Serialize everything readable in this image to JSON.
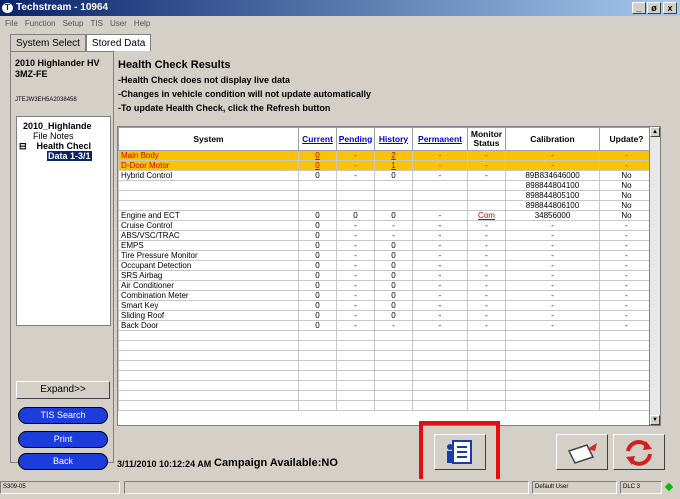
{
  "window": {
    "title": "Techstream - 10964",
    "min": "_",
    "max": "ø",
    "close": "x",
    "icon": "T"
  },
  "menu": [
    "File",
    "Function",
    "Setup",
    "TIS",
    "User",
    "Help"
  ],
  "tabs": [
    "System Select",
    "Stored Data"
  ],
  "vehicle": {
    "line1": "2010 Highlander HV",
    "line2": "3MZ-FE",
    "vin": "JTEJW3EH5A2038458"
  },
  "tree": {
    "root": "2010_Highlande",
    "file_notes": "File Notes",
    "toggle": "⊟",
    "health": "Health Checl",
    "data": "Data 1-3/1"
  },
  "left_buttons": {
    "expand": "Expand>>",
    "tis_search": "TIS Search",
    "print": "Print",
    "back": "Back"
  },
  "health": {
    "title": "Health Check Results",
    "notes": [
      "-Health Check does not display live data",
      "-Changes in vehicle condition will not update automatically",
      "-To update Health Check, click the Refresh button"
    ]
  },
  "table": {
    "headers": [
      "System",
      "Current",
      "Pending",
      "History",
      "Permanent",
      "Monitor Status",
      "Calibration",
      "Update?"
    ],
    "rows": [
      {
        "sys": "Main Body",
        "cur": "0",
        "pen": "-",
        "his": "2",
        "perm": "-",
        "mon": "-",
        "cal": "-",
        "upd": "-",
        "hl": true
      },
      {
        "sys": "D-Door Motor",
        "cur": "0",
        "pen": "-",
        "his": "1",
        "perm": "-",
        "mon": "-",
        "cal": "-",
        "upd": "-",
        "hl": true
      },
      {
        "sys": "Hybrid Control",
        "cur": "0",
        "pen": "-",
        "his": "0",
        "perm": "-",
        "mon": "-",
        "cal": "89B834646000",
        "upd": "No"
      },
      {
        "sys": "",
        "cur": "",
        "pen": "",
        "his": "",
        "perm": "",
        "mon": "",
        "cal": "898844804100",
        "upd": "No"
      },
      {
        "sys": "",
        "cur": "",
        "pen": "",
        "his": "",
        "perm": "",
        "mon": "",
        "cal": "898844805100",
        "upd": "No"
      },
      {
        "sys": "",
        "cur": "",
        "pen": "",
        "his": "",
        "perm": "",
        "mon": "",
        "cal": "898844806100",
        "upd": "No"
      },
      {
        "sys": "Engine and ECT",
        "cur": "0",
        "pen": "0",
        "his": "0",
        "perm": "-",
        "mon": "Com",
        "cal": "34856000",
        "upd": "No"
      },
      {
        "sys": "Cruise Control",
        "cur": "0",
        "pen": "-",
        "his": "-",
        "perm": "-",
        "mon": "-",
        "cal": "-",
        "upd": "-"
      },
      {
        "sys": "ABS/VSC/TRAC",
        "cur": "0",
        "pen": "-",
        "his": "-",
        "perm": "-",
        "mon": "-",
        "cal": "-",
        "upd": "-"
      },
      {
        "sys": "EMPS",
        "cur": "0",
        "pen": "-",
        "his": "0",
        "perm": "-",
        "mon": "-",
        "cal": "-",
        "upd": "-"
      },
      {
        "sys": "Tire Pressure Monitor",
        "cur": "0",
        "pen": "-",
        "his": "0",
        "perm": "-",
        "mon": "-",
        "cal": "-",
        "upd": "-"
      },
      {
        "sys": "Occupant Detection",
        "cur": "0",
        "pen": "-",
        "his": "0",
        "perm": "-",
        "mon": "-",
        "cal": "-",
        "upd": "-"
      },
      {
        "sys": "SRS Airbag",
        "cur": "0",
        "pen": "-",
        "his": "0",
        "perm": "-",
        "mon": "-",
        "cal": "-",
        "upd": "-"
      },
      {
        "sys": "Air Conditioner",
        "cur": "0",
        "pen": "-",
        "his": "0",
        "perm": "-",
        "mon": "-",
        "cal": "-",
        "upd": "-"
      },
      {
        "sys": "Combination Meter",
        "cur": "0",
        "pen": "-",
        "his": "0",
        "perm": "-",
        "mon": "-",
        "cal": "-",
        "upd": "-"
      },
      {
        "sys": "Smart Key",
        "cur": "0",
        "pen": "-",
        "his": "0",
        "perm": "-",
        "mon": "-",
        "cal": "-",
        "upd": "-"
      },
      {
        "sys": "Sliding Roof",
        "cur": "0",
        "pen": "-",
        "his": "0",
        "perm": "-",
        "mon": "-",
        "cal": "-",
        "upd": "-"
      },
      {
        "sys": "Back Door",
        "cur": "0",
        "pen": "-",
        "his": "-",
        "perm": "-",
        "mon": "-",
        "cal": "-",
        "upd": "-"
      }
    ]
  },
  "scroll": {
    "up": "▲",
    "down": "▼"
  },
  "footer": {
    "timestamp": "3/11/2010 10:12:24 AM",
    "campaign": "Campaign Available:NO"
  },
  "status": {
    "code": "S309-05",
    "user": "Default User",
    "dlc": "DLC 3"
  },
  "colors": {
    "highlight_row": "#fcc300",
    "accent_red": "#e01010",
    "button_blue": "#1c3cdc"
  }
}
